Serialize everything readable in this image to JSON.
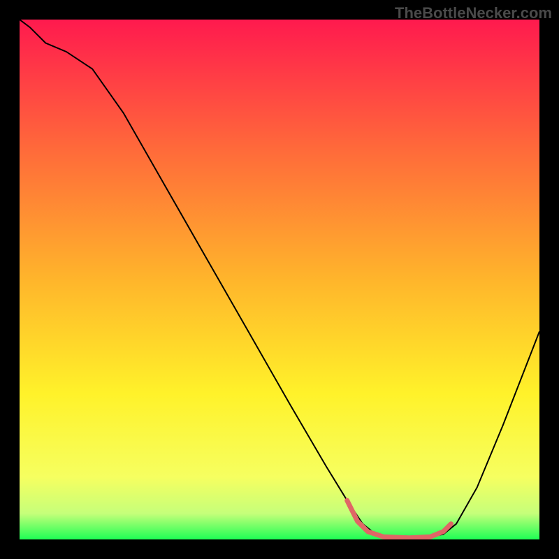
{
  "watermark": "TheBottleNecker.com",
  "chart_data": {
    "type": "line",
    "title": "",
    "xlabel": "",
    "ylabel": "",
    "xlim": [
      0,
      100
    ],
    "ylim": [
      0,
      100
    ],
    "gradient_stops": [
      {
        "offset": 0,
        "color": "#ff1a4e"
      },
      {
        "offset": 25,
        "color": "#ff6a3a"
      },
      {
        "offset": 50,
        "color": "#ffb52b"
      },
      {
        "offset": 72,
        "color": "#fff22a"
      },
      {
        "offset": 88,
        "color": "#f6ff60"
      },
      {
        "offset": 95,
        "color": "#c6ff7a"
      },
      {
        "offset": 100,
        "color": "#1eff55"
      }
    ],
    "series": [
      {
        "name": "bottleneck-curve",
        "color": "#000000",
        "points": [
          {
            "x": 0.0,
            "y": 100.0
          },
          {
            "x": 2.0,
            "y": 98.5
          },
          {
            "x": 5.0,
            "y": 95.5
          },
          {
            "x": 9.0,
            "y": 93.8
          },
          {
            "x": 14.0,
            "y": 90.5
          },
          {
            "x": 20.0,
            "y": 82.0
          },
          {
            "x": 28.0,
            "y": 68.0
          },
          {
            "x": 36.0,
            "y": 54.0
          },
          {
            "x": 44.0,
            "y": 40.0
          },
          {
            "x": 52.0,
            "y": 26.0
          },
          {
            "x": 59.0,
            "y": 14.0
          },
          {
            "x": 63.0,
            "y": 7.5
          },
          {
            "x": 66.0,
            "y": 3.0
          },
          {
            "x": 68.5,
            "y": 1.0
          },
          {
            "x": 72.0,
            "y": 0.3
          },
          {
            "x": 78.0,
            "y": 0.3
          },
          {
            "x": 81.5,
            "y": 1.0
          },
          {
            "x": 84.0,
            "y": 3.0
          },
          {
            "x": 88.0,
            "y": 10.0
          },
          {
            "x": 93.0,
            "y": 22.0
          },
          {
            "x": 100.0,
            "y": 40.0
          }
        ]
      },
      {
        "name": "trough-highlight",
        "color": "#e06666",
        "stroke_width": 7,
        "points": [
          {
            "x": 63.0,
            "y": 7.5
          },
          {
            "x": 65.0,
            "y": 3.5
          },
          {
            "x": 67.0,
            "y": 1.5
          },
          {
            "x": 70.0,
            "y": 0.5
          },
          {
            "x": 75.0,
            "y": 0.3
          },
          {
            "x": 79.0,
            "y": 0.5
          },
          {
            "x": 81.5,
            "y": 1.5
          },
          {
            "x": 83.0,
            "y": 3.0
          }
        ]
      }
    ]
  }
}
